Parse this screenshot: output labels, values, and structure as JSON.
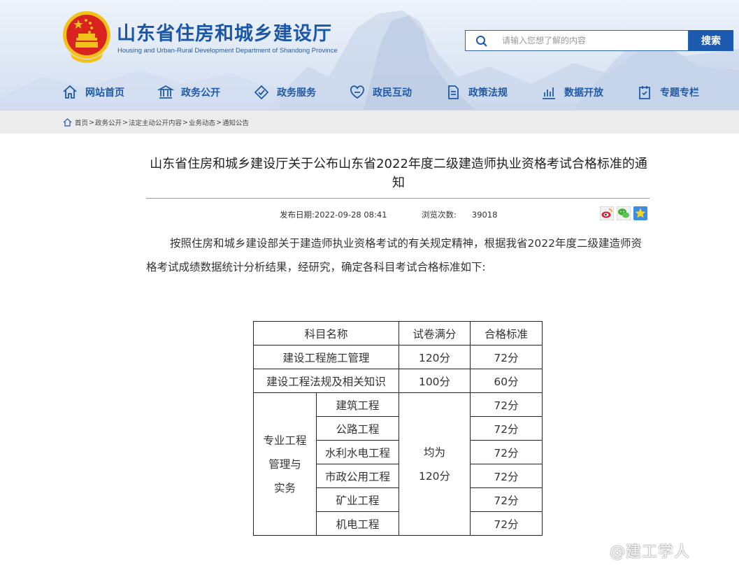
{
  "header": {
    "title": "山东省住房和城乡建设厅",
    "subtitle": "Housing and Urban-Rural Development Department of Shandong Province",
    "search": {
      "placeholder": "请输入您想了解的内容",
      "button_label": "搜索"
    },
    "nav": [
      {
        "label": "网站首页",
        "icon": "home-icon"
      },
      {
        "label": "政务公开",
        "icon": "government-building-icon"
      },
      {
        "label": "政务服务",
        "icon": "handshake-icon"
      },
      {
        "label": "政民互动",
        "icon": "interaction-icon"
      },
      {
        "label": "政策法规",
        "icon": "policy-document-icon"
      },
      {
        "label": "数据开放",
        "icon": "data-chart-icon"
      },
      {
        "label": "专题专栏",
        "icon": "topic-column-icon"
      }
    ]
  },
  "breadcrumb": [
    "首页",
    "政务公开",
    "法定主动公开内容",
    "业务动态",
    "通知公告"
  ],
  "article": {
    "title": "山东省住房和城乡建设厅关于公布山东省2022年度二级建造师执业资格考试合格标准的通知",
    "publish_label": "发布日期:",
    "publish_date": "2022-09-28 08:41",
    "views_label": "浏览次数:",
    "views": "39018",
    "share_icons": [
      "weibo-icon",
      "wechat-icon",
      "favorite-star-icon"
    ],
    "body": "按照住房和城乡建设部关于建造师执业资格考试的有关规定精神，根据我省2022年度二级建造师资格考试成绩数据统计分析结果，经研究，确定各科目考试合格标准如下:"
  },
  "table": {
    "headers": [
      "科目名称",
      "试卷满分",
      "合格标准"
    ],
    "rows": [
      {
        "subject": "建设工程施工管理",
        "full_score": "120分",
        "pass": "72分"
      },
      {
        "subject": "建设工程法规及相关知识",
        "full_score": "100分",
        "pass": "60分"
      }
    ],
    "group": {
      "label_lines": [
        "专业工程",
        "管理与",
        "实务"
      ],
      "full_score_lines": [
        "均为",
        "120分"
      ],
      "items": [
        {
          "subject": "建筑工程",
          "pass": "72分"
        },
        {
          "subject": "公路工程",
          "pass": "72分"
        },
        {
          "subject": "水利水电工程",
          "pass": "72分"
        },
        {
          "subject": "市政公用工程",
          "pass": "72分"
        },
        {
          "subject": "矿业工程",
          "pass": "72分"
        },
        {
          "subject": "机电工程",
          "pass": "72分"
        }
      ]
    }
  },
  "watermark": "@建工学人",
  "colors": {
    "brand_blue": "#1a57a8",
    "search_button": "#1d5bb0",
    "emblem_red": "#d8231f",
    "emblem_gold": "#f3c11b"
  }
}
